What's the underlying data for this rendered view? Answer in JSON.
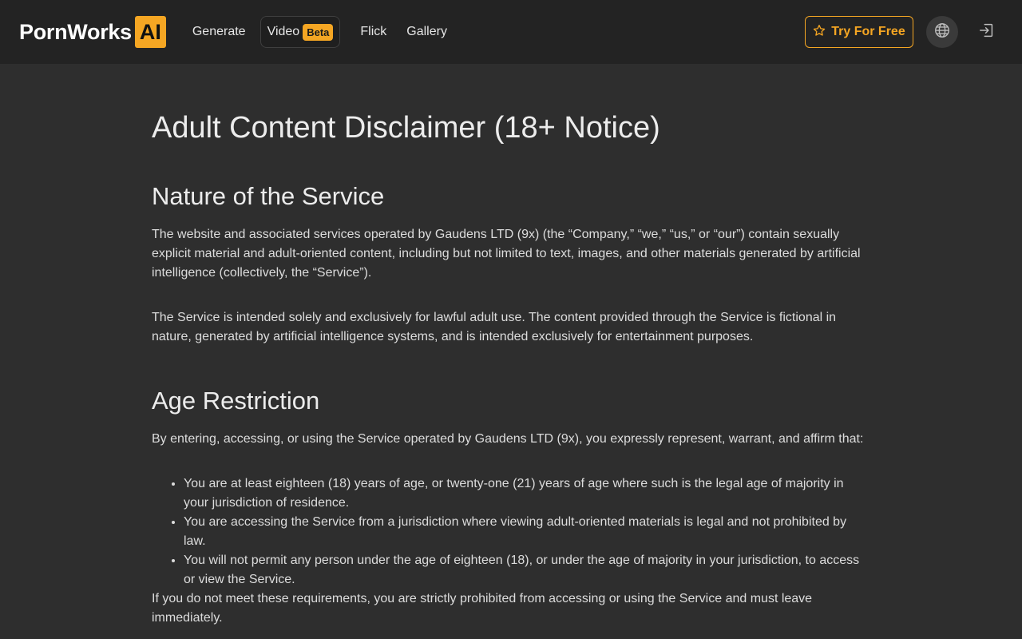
{
  "header": {
    "logo_text": "PornWorks",
    "logo_badge": "AI",
    "nav": [
      {
        "label": "Generate"
      },
      {
        "label": "Video",
        "badge": "Beta"
      },
      {
        "label": "Flick"
      },
      {
        "label": "Gallery"
      }
    ],
    "cta_label": "Try For Free",
    "icons": {
      "cta": "star-icon",
      "language": "globe-icon",
      "login": "login-icon"
    }
  },
  "colors": {
    "accent": "#f5a623",
    "header_bg": "#232323",
    "page_bg": "#2e2e2e"
  },
  "content": {
    "title": "Adult Content Disclaimer (18+ Notice)",
    "sections": [
      {
        "heading": "Nature of the Service",
        "paragraphs": [
          "The website and associated services operated by Gaudens LTD (9x) (the “Company,” “we,” “us,” or “our”) contain sexually explicit material and adult-oriented content, including but not limited to text, images, and other materials generated by artificial intelligence (collectively, the “Service”).",
          "The Service is intended solely and exclusively for lawful adult use. The content provided through the Service is fictional in nature, generated by artificial intelligence systems, and is intended exclusively for entertainment purposes."
        ]
      },
      {
        "heading": "Age Restriction",
        "intro": "By entering, accessing, or using the Service operated by Gaudens LTD (9x), you expressly represent, warrant, and affirm that:",
        "bullets": [
          "You are at least eighteen (18) years of age, or twenty-one (21) years of age where such is the legal age of majority in your jurisdiction of residence.",
          "You are accessing the Service from a jurisdiction where viewing adult-oriented materials is legal and not prohibited by law.",
          "You will not permit any person under the age of eighteen (18), or under the age of majority in your jurisdiction, to access or view the Service."
        ],
        "outro": "If you do not meet these requirements, you are strictly prohibited from accessing or using the Service and must leave immediately."
      }
    ]
  }
}
